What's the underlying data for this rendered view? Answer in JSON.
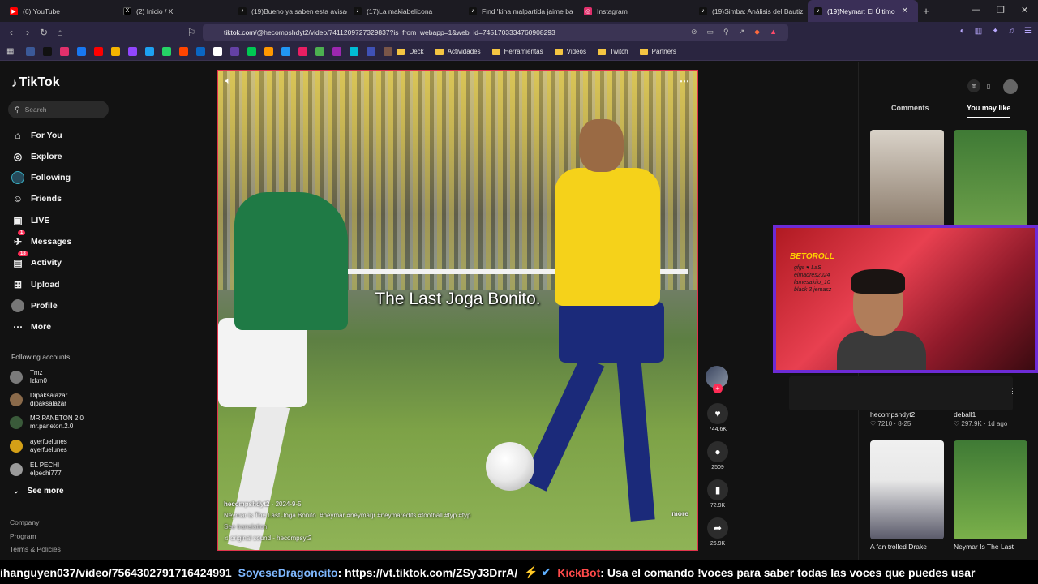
{
  "tabs": [
    {
      "label": "(6) YouTube",
      "color": "#ff0000",
      "glyph": "▶"
    },
    {
      "label": "(2) Inicio / X",
      "color": "#000000",
      "glyph": "X"
    },
    {
      "label": "(19)Bueno ya saben esta avisad",
      "color": "#111111",
      "glyph": "♪"
    },
    {
      "label": "(17)La makiabelicona",
      "color": "#111111",
      "glyph": "♪"
    },
    {
      "label": "Find 'kina malpartida jaime ba",
      "color": "#111111",
      "glyph": "♪"
    },
    {
      "label": "Instagram",
      "color": "#e1306c",
      "glyph": "◎"
    },
    {
      "label": "(19)Simba: Análisis del Bautiz",
      "color": "#111111",
      "glyph": "♪"
    },
    {
      "label": "(19)Neymar: El Último",
      "color": "#111111",
      "glyph": "♪"
    }
  ],
  "address": {
    "host": "tiktok.com",
    "path": "/@hecompshdyt2/video/7411209727329837?is_from_webapp=1&web_id=7451703334760908293"
  },
  "bookmarks": {
    "folders": [
      "Deck",
      "Actividades",
      "Herramientas",
      "Videos",
      "Twitch",
      "Partners"
    ],
    "icon_colors": [
      "#3b5998",
      "#111111",
      "#e1306c",
      "#1877f2",
      "#ff0000",
      "#f4b400",
      "#9146ff",
      "#1da1f2",
      "#25d366",
      "#ff4500",
      "#0a66c2",
      "#ffffff",
      "#6441a5",
      "#00c853",
      "#ff9800",
      "#2196f3",
      "#e91e63",
      "#4caf50",
      "#9c27b0",
      "#00bcd4",
      "#3f51b5",
      "#795548"
    ]
  },
  "sidebar": {
    "logo": "TikTok",
    "search_placeholder": "Search",
    "nav": [
      {
        "label": "For You",
        "icon": "home-icon",
        "glyph": "⌂"
      },
      {
        "label": "Explore",
        "icon": "compass-icon",
        "glyph": "◎"
      },
      {
        "label": "Following",
        "icon": "following-icon",
        "glyph": "◉"
      },
      {
        "label": "Friends",
        "icon": "friends-icon",
        "glyph": "☺"
      },
      {
        "label": "LIVE",
        "icon": "live-icon",
        "glyph": "▣"
      },
      {
        "label": "Messages",
        "icon": "messages-icon",
        "glyph": "✈",
        "badge": "1"
      },
      {
        "label": "Activity",
        "icon": "activity-icon",
        "glyph": "▤",
        "badge": "18"
      },
      {
        "label": "Upload",
        "icon": "upload-icon",
        "glyph": "⊞"
      },
      {
        "label": "Profile",
        "icon": "profile-icon",
        "glyph": "●"
      },
      {
        "label": "More",
        "icon": "more-icon",
        "glyph": "⋯"
      }
    ],
    "following_header": "Following accounts",
    "accounts": [
      {
        "name": "Tmz",
        "handle": "lzkm0",
        "color": "#7a7a7a"
      },
      {
        "name": "Dipaksalazar",
        "handle": "dipaksalazar",
        "color": "#8a6a4a"
      },
      {
        "name": "MR PANETON 2.0",
        "handle": "mr.paneton.2.0",
        "color": "#3a5a3a"
      },
      {
        "name": "ayerfuelunes",
        "handle": "ayerfuelunes",
        "color": "#d4a017"
      },
      {
        "name": "EL PECHI",
        "handle": "elpechi777",
        "color": "#9a9a9a"
      }
    ],
    "see_more": "See more",
    "footer": [
      "Company",
      "Program",
      "Terms & Policies"
    ]
  },
  "video": {
    "caption_overlay": "The Last Joga Bonito.",
    "author": "hecompshdyt2",
    "date": "2024-9-5",
    "description": "Neymar is The Last Joga Bonito",
    "hashtags": "#neymar #neymarjr #neymaredits #football #fyp #fyp",
    "more": "more",
    "see_translation": "See translation",
    "sound": "original sound - hecompsyt2"
  },
  "actions": {
    "likes": "744.6K",
    "comments": "2509",
    "saves": "72.9K",
    "shares": "26.9K"
  },
  "right_panel": {
    "tabs": [
      "Comments",
      "You may like"
    ],
    "thumbs": [
      {
        "title": "",
        "user": "",
        "stats": "",
        "c1": "#d9d2c8",
        "c2": "#8a7a6a"
      },
      {
        "title": "",
        "user": "",
        "stats": "",
        "c1": "#3f7a35",
        "c2": "#6da04a"
      },
      {
        "title": "",
        "user": "hecompshdyt2",
        "stats": "♡ 7210 · 8-25",
        "c1": "#c9a56a",
        "c2": "#6a5a3a"
      },
      {
        "title": "",
        "user": "deball1",
        "stats": "♡ 297.9K · 1d ago",
        "c1": "#3a6a35",
        "c2": "#5a8a4a"
      },
      {
        "title": "A fan trolled Drake",
        "user": "",
        "stats": "",
        "c1": "#e8e8e8",
        "c2": "#5a5a6a"
      },
      {
        "title": "Neymar Is The Last",
        "user": "",
        "stats": "",
        "c1": "#3f7a35",
        "c2": "#7ab04a"
      }
    ]
  },
  "stream_overlay": {
    "logo": "BETOROLL",
    "scribble": "gfgs ♥ LaS elmadres2024 lamesakilo_10 black 3 jemasz"
  },
  "ticker": {
    "lead": "ihanguyen037/video/7564302791716424991",
    "user1": "SoyeseDragoncito",
    "msg1": ": https://vt.tiktok.com/ZSyJ3DrrA/",
    "badges": "⚡ ✔",
    "user2": "KickBot",
    "msg2": ": Usa el comando !voces para saber todas las voces que puedes usar"
  }
}
